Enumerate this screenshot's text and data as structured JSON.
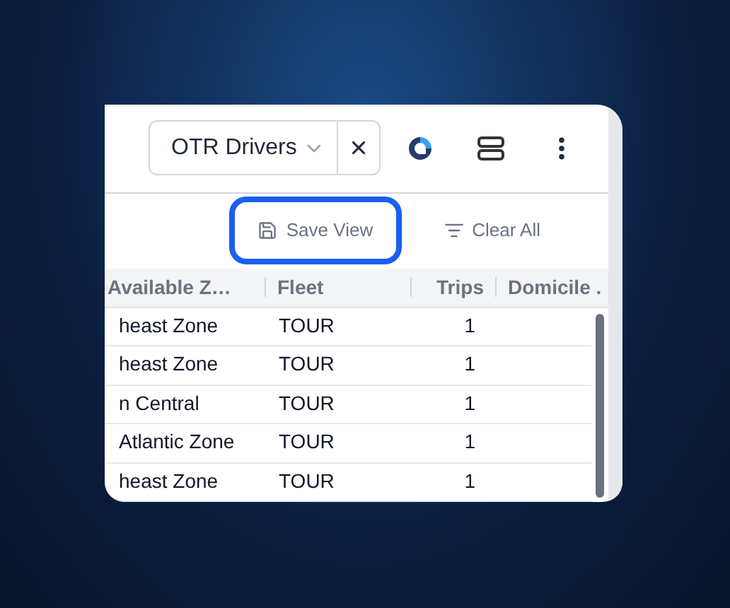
{
  "view_select": {
    "value": "OTR Drivers"
  },
  "toolbar": [
    {
      "label": "Save View",
      "kind": "save",
      "highlighted": true
    },
    {
      "label": "Clear All",
      "kind": "clear",
      "highlighted": false
    }
  ],
  "table": {
    "columns": [
      "Available Z…",
      "Fleet",
      "Trips",
      "Domicile ."
    ],
    "rows": [
      [
        "heast Zone",
        "TOUR",
        "1"
      ],
      [
        "heast Zone",
        "TOUR",
        "1"
      ],
      [
        "n Central",
        "TOUR",
        "1"
      ],
      [
        "Atlantic Zone",
        "TOUR",
        "1"
      ],
      [
        "heast Zone",
        "TOUR",
        "1"
      ]
    ]
  }
}
